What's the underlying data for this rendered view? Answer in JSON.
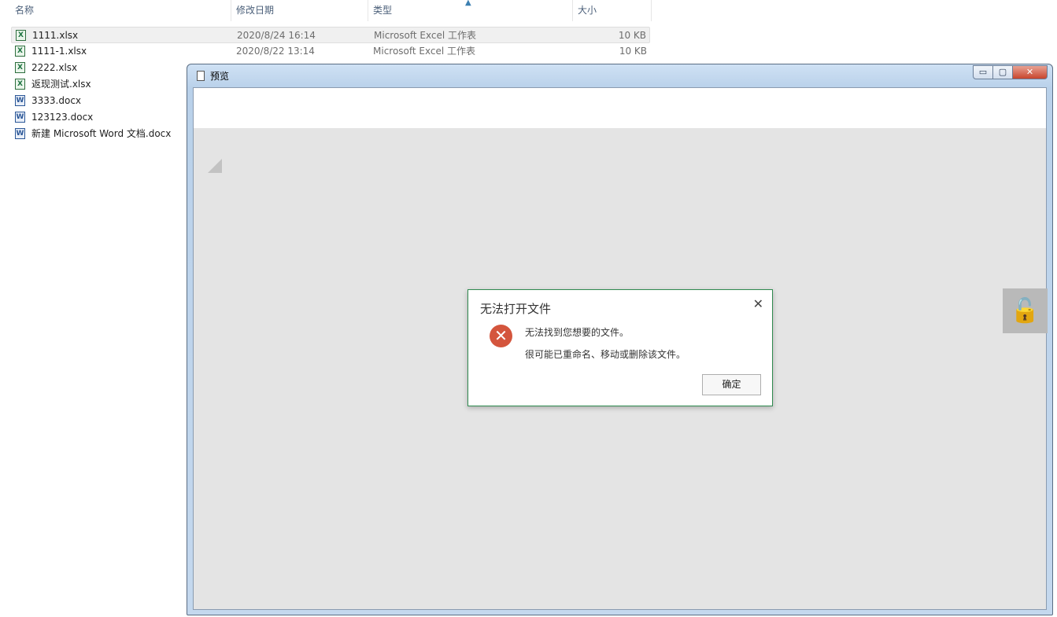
{
  "explorer": {
    "columns": {
      "name": "名称",
      "date": "修改日期",
      "type": "类型",
      "size": "大小"
    },
    "files": [
      {
        "name": "1111.xlsx",
        "date": "2020/8/24 16:14",
        "type": "Microsoft Excel 工作表",
        "size": "10 KB",
        "icon": "excel-file-icon"
      },
      {
        "name": "1111-1.xlsx",
        "date": "2020/8/22 13:14",
        "type": "Microsoft Excel 工作表",
        "size": "10 KB",
        "icon": "excel-file-icon"
      },
      {
        "name": "2222.xlsx",
        "icon": "excel-file-icon"
      },
      {
        "name": "返现测试.xlsx",
        "icon": "excel-file-icon"
      },
      {
        "name": "3333.docx",
        "icon": "word-file-icon"
      },
      {
        "name": "123123.docx",
        "icon": "word-file-icon"
      },
      {
        "name": "新建 Microsoft Word 文档.docx",
        "icon": "word-file-icon"
      }
    ]
  },
  "preview_window": {
    "title": "预览",
    "minimize_glyph": "▭",
    "maximize_glyph": "▢",
    "close_glyph": "✕",
    "lock_glyph": "🔓"
  },
  "dialog": {
    "title": "无法打开文件",
    "close_glyph": "✕",
    "error_glyph": "✕",
    "message_primary": "无法找到您想要的文件。",
    "message_secondary": "很可能已重命名、移动或删除该文件。",
    "ok_label": "确定"
  },
  "colors": {
    "dialog_border": "#2f8a4f",
    "error_icon": "#d4553d",
    "close_button": "#c8452d"
  }
}
